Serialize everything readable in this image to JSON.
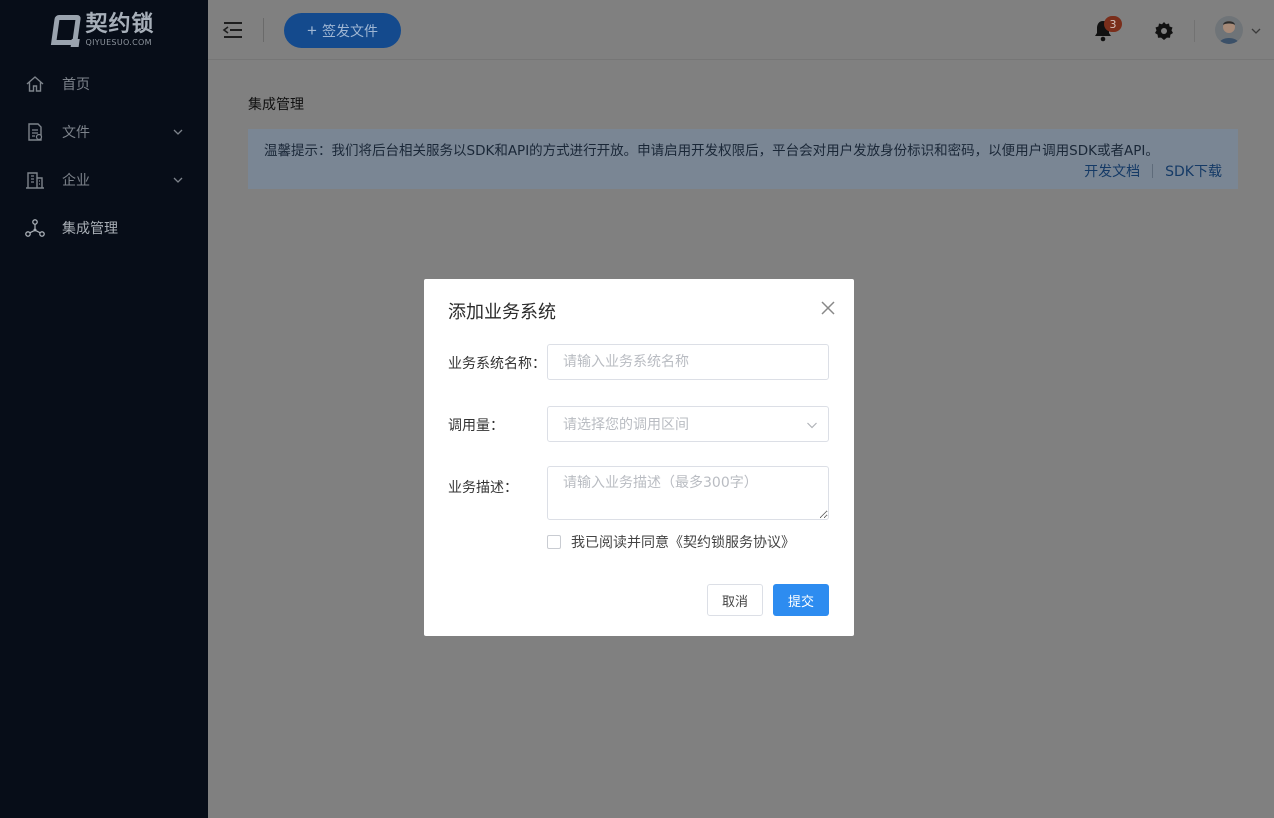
{
  "app": {
    "logo_cn": "契约锁",
    "logo_en": "QIYUESUO.COM"
  },
  "sidebar": {
    "items": [
      {
        "label": "首页",
        "icon": "home-icon"
      },
      {
        "label": "文件",
        "icon": "file-icon"
      },
      {
        "label": "企业",
        "icon": "building-icon"
      },
      {
        "label": "集成管理",
        "icon": "integration-icon"
      }
    ]
  },
  "header": {
    "sign_button": "签发文件",
    "notification_count": "3"
  },
  "main": {
    "section_title": "集成管理",
    "notice": {
      "text": "温馨提示：我们将后台相关服务以SDK和API的方式进行开放。申请启用开发权限后，平台会对用户发放身份标识和密码，以便用户调用SDK或者API。",
      "link_docs": "开发文档",
      "link_sdk": "SDK下载"
    }
  },
  "modal": {
    "title": "添加业务系统",
    "name_label": "业务系统名称：",
    "name_placeholder": "请输入业务系统名称",
    "volume_label": "调用量：",
    "volume_placeholder": "请选择您的调用区间",
    "desc_label": "业务描述：",
    "desc_placeholder": "请输入业务描述（最多300字）",
    "agree_text": "我已阅读并同意《契约锁服务协议》",
    "cancel_label": "取消",
    "submit_label": "提交"
  },
  "colors": {
    "sidebar_bg": "#070d18",
    "overlay_bg": "#808080",
    "primary": "#2d8cf0"
  }
}
